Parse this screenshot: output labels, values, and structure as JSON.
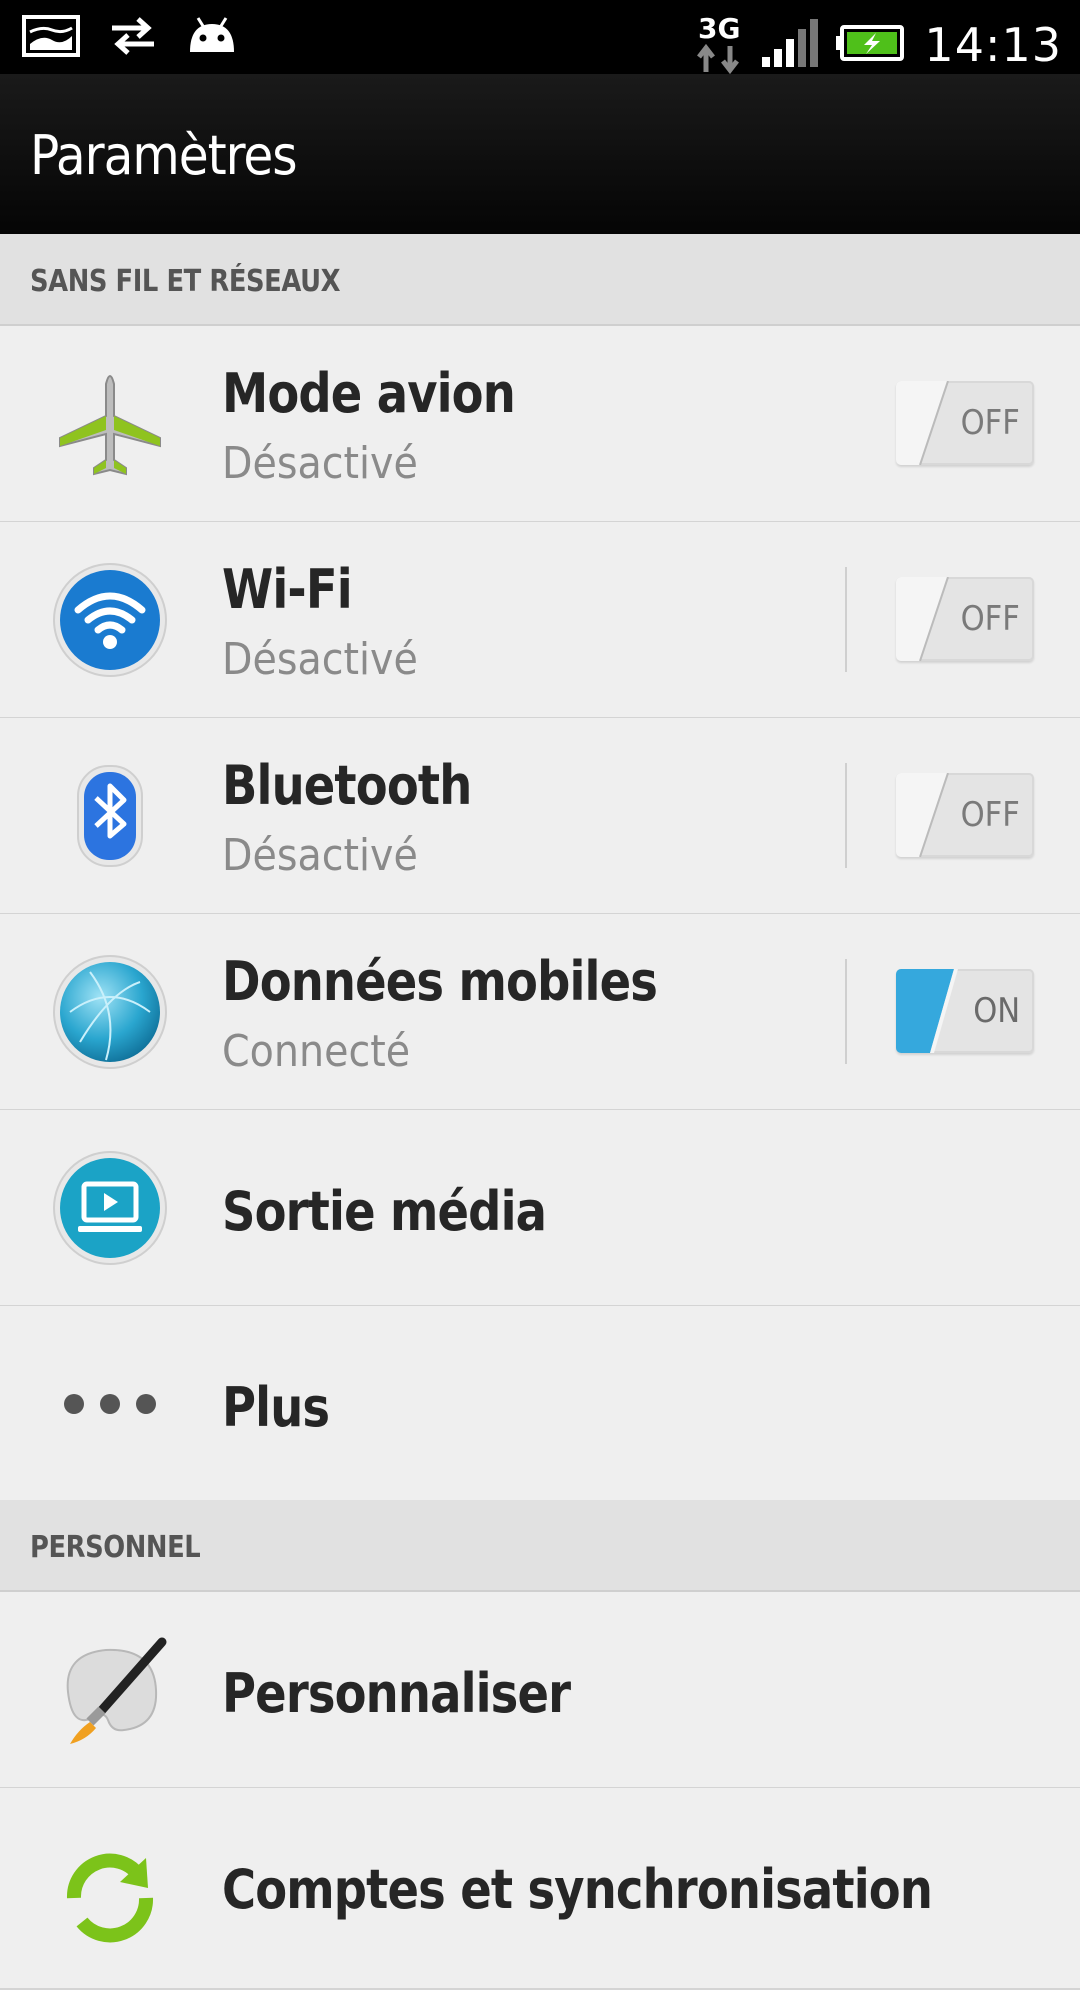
{
  "status_bar": {
    "time": "14:13",
    "network": "3G",
    "icons": [
      "image-notification-icon",
      "sync-arrows-icon",
      "android-debug-icon",
      "data-3g-icon",
      "signal-icon",
      "battery-charging-icon"
    ]
  },
  "header": {
    "title": "Paramètres"
  },
  "sections": {
    "wireless": {
      "label": "SANS FIL ET RÉSEAUX"
    },
    "personal": {
      "label": "PERSONNEL"
    }
  },
  "items": {
    "airplane": {
      "title": "Mode avion",
      "subtitle": "Désactivé",
      "toggle": "OFF"
    },
    "wifi": {
      "title": "Wi-Fi",
      "subtitle": "Désactivé",
      "toggle": "OFF"
    },
    "bluetooth": {
      "title": "Bluetooth",
      "subtitle": "Désactivé",
      "toggle": "OFF"
    },
    "mobile_data": {
      "title": "Données mobiles",
      "subtitle": "Connecté",
      "toggle": "ON"
    },
    "media_output": {
      "title": "Sortie média"
    },
    "more": {
      "title": "Plus"
    },
    "personalize": {
      "title": "Personnaliser"
    },
    "accounts_sync": {
      "title": "Comptes et synchronisation"
    }
  },
  "colors": {
    "toggle_on": "#35a8dd",
    "wifi_blue": "#1a7bd0",
    "bluetooth_blue": "#2c74e0",
    "sync_green": "#7cc31a",
    "airplane_green": "#8fc31f"
  }
}
